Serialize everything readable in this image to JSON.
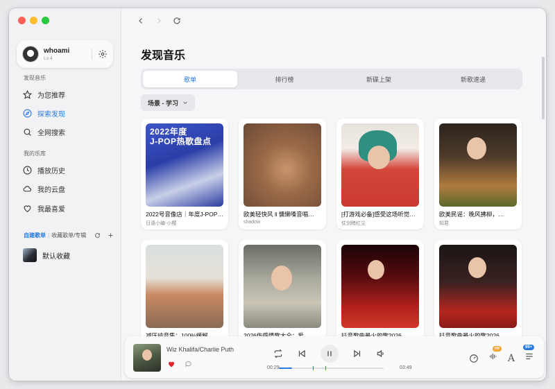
{
  "user": {
    "name": "whoami",
    "level": "Lv.4"
  },
  "sidebar": {
    "section_discover": "发现音乐",
    "discover_items": [
      "为您推荐",
      "探索发现",
      "全网搜索"
    ],
    "section_library": "我的乐库",
    "library_items": [
      "播放历史",
      "我的云盘",
      "我最喜爱"
    ],
    "playlist_tab_active": "自建歌单",
    "playlist_tab_other": "收藏歌单/专辑",
    "favorites_label": "默认收藏"
  },
  "page": {
    "title": "发现音乐",
    "tabs": [
      "歌单",
      "排行榜",
      "新碟上架",
      "新歌速递"
    ],
    "filter_label": "场景 - 学习"
  },
  "cards": [
    {
      "title": "2022号音像店｜年度J-POP热歌盘点",
      "subtitle": "日语小编-小樱",
      "cover_text": "2022年度\nJ-POP热歌盘点"
    },
    {
      "title": "欧美轻快风 ‖ 慵懒嗓音唱…",
      "subtitle": "shadow"
    },
    {
      "title": "[打游戏必备]感受这场听觉盛宴",
      "subtitle": "仗剑睹红尘"
    },
    {
      "title": "欧美民谣：晚风拂柳，…",
      "subtitle": "知君"
    },
    {
      "title": "减压纯音集：100%缓解",
      "subtitle": ""
    },
    {
      "title": "2026伤感情歌大全：爱",
      "subtitle": ""
    },
    {
      "title": "抖音歌曲最火的歌2026",
      "subtitle": ""
    },
    {
      "title": "抖音歌曲最火的歌2026",
      "subtitle": ""
    }
  ],
  "player": {
    "artist": "Wiz Khalifa/Charlie Puth",
    "elapsed": "00:29",
    "duration": "03:49",
    "progress_fraction": 0.127,
    "badge_hr": "HR",
    "badge_queue": "99+"
  },
  "colors": {
    "accent": "#2a7ae2",
    "heart": "#e0252f"
  }
}
